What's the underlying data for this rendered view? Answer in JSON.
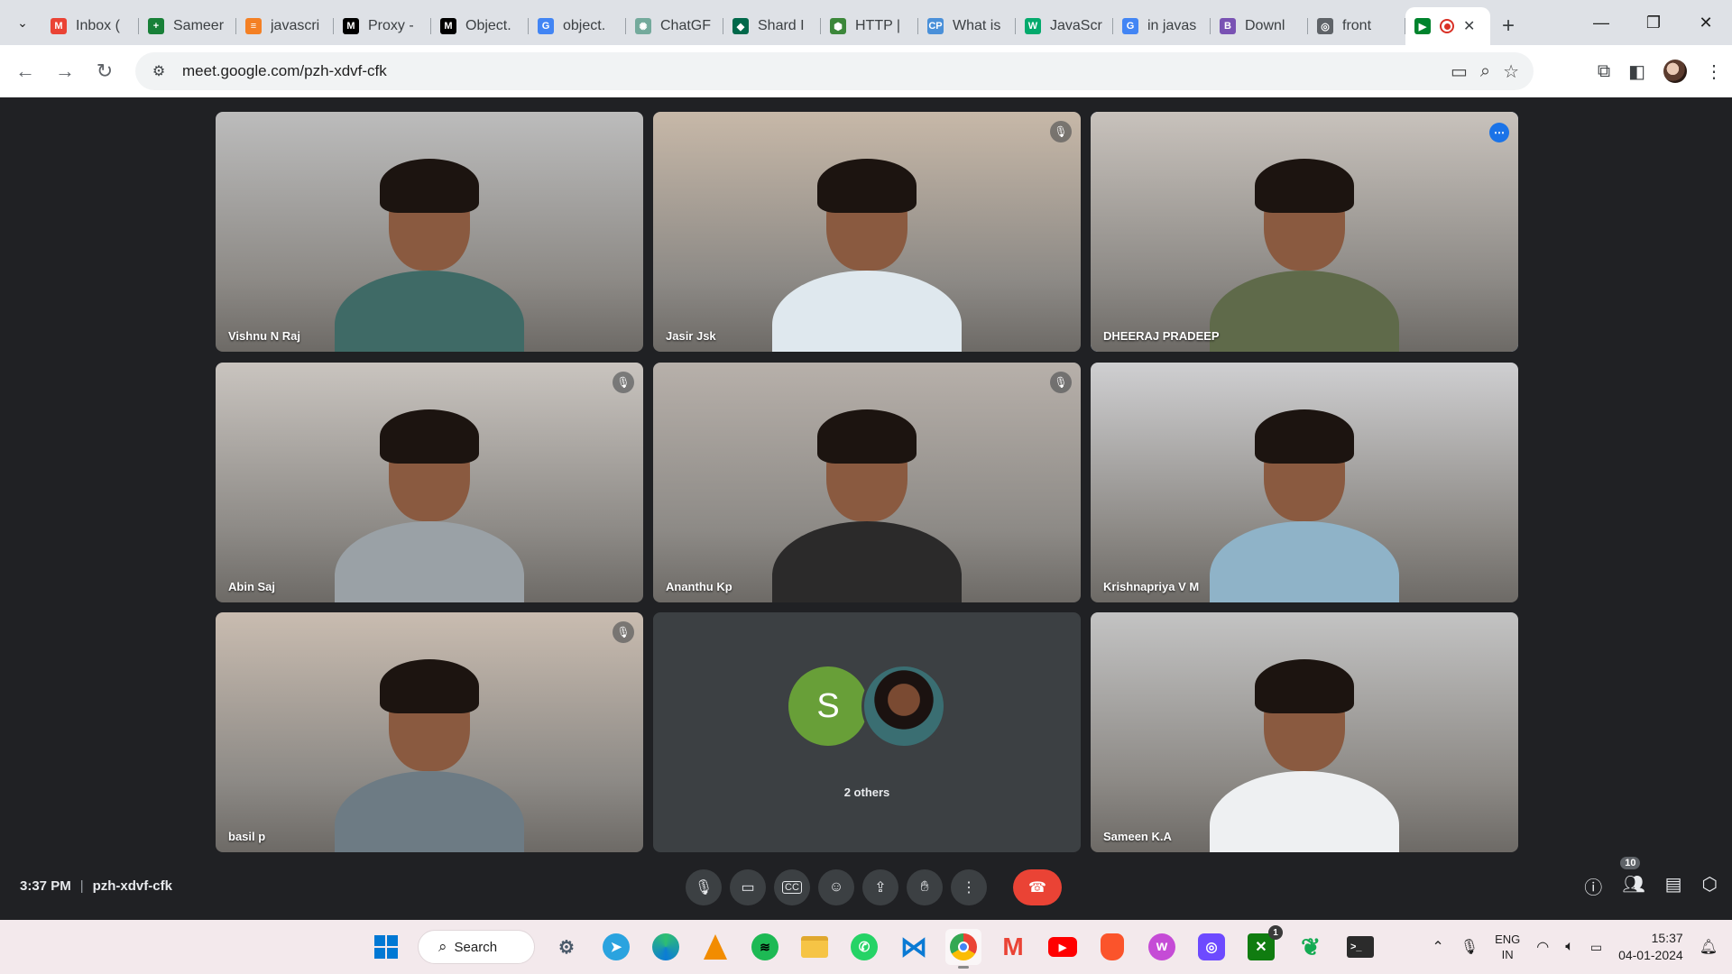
{
  "browser": {
    "tabs": [
      {
        "title": "Inbox (",
        "icon": "gmail-icon",
        "color": "#ea4335",
        "glyph": "M"
      },
      {
        "title": "Sameer",
        "icon": "sheets-icon",
        "color": "#188038",
        "glyph": "+"
      },
      {
        "title": "javascri",
        "icon": "stackoverflow-icon",
        "color": "#f48024",
        "glyph": "≡"
      },
      {
        "title": "Proxy -",
        "icon": "medium-icon",
        "color": "#000000",
        "glyph": "M"
      },
      {
        "title": "Object.",
        "icon": "medium-icon",
        "color": "#000000",
        "glyph": "M"
      },
      {
        "title": "object.",
        "icon": "google-icon",
        "color": "#4285f4",
        "glyph": "G"
      },
      {
        "title": "ChatGF",
        "icon": "chatgpt-icon",
        "color": "#74aa9c",
        "glyph": "✺"
      },
      {
        "title": "Shard I",
        "icon": "mongodb-icon",
        "color": "#00684a",
        "glyph": "◆"
      },
      {
        "title": "HTTP |",
        "icon": "nodejs-icon",
        "color": "#3c873a",
        "glyph": "⬢"
      },
      {
        "title": "What is",
        "icon": "codeproject-icon",
        "color": "#4a90d9",
        "glyph": "CP"
      },
      {
        "title": "JavaScr",
        "icon": "w3schools-icon",
        "color": "#04aa6d",
        "glyph": "W"
      },
      {
        "title": "in javas",
        "icon": "google-icon",
        "color": "#4285f4",
        "glyph": "G"
      },
      {
        "title": "Downl",
        "icon": "bootstrap-icon",
        "color": "#7952b3",
        "glyph": "B"
      },
      {
        "title": "front",
        "icon": "globe-icon",
        "color": "#5f6368",
        "glyph": "◎"
      }
    ],
    "active_tab": {
      "icon": "meet-icon"
    },
    "url": "meet.google.com/pzh-xdvf-cfk"
  },
  "meeting": {
    "participants": [
      {
        "name": "Vishnu N Raj",
        "muted": false,
        "bg": "#bcbcbc",
        "shirt": "#3f6a66"
      },
      {
        "name": "Jasir Jsk",
        "muted": true,
        "bg": "#c7b8a8",
        "shirt": "#dfe8ee"
      },
      {
        "name": "DHEERAJ PRADEEP",
        "muted": false,
        "bg": "#c8c2bc",
        "shirt": "#5f6a4a",
        "active": true
      },
      {
        "name": "Abin Saj",
        "muted": true,
        "bg": "#c9c4bf",
        "shirt": "#9aa1a6"
      },
      {
        "name": "Ananthu Kp",
        "muted": true,
        "bg": "#b7b0aa",
        "shirt": "#2b2a2a"
      },
      {
        "name": "Krishnapriya V M",
        "muted": false,
        "bg": "#cfcfd1",
        "shirt": "#8fb3c8"
      },
      {
        "name": "basil p",
        "muted": true,
        "bg": "#c9bcb0",
        "shirt": "#6d7b84"
      },
      {
        "name": "Sameen K.A",
        "muted": false,
        "bg": "#c3c3c3",
        "shirt": "#eef0f2"
      }
    ],
    "others": {
      "label": "2 others",
      "initial": "S",
      "initial_color": "#689f38"
    },
    "time": "3:37 PM",
    "code": "pzh-xdvf-cfk",
    "people_count": "10"
  },
  "taskbar": {
    "search_label": "Search",
    "lang_line1": "ENG",
    "lang_line2": "IN",
    "time": "15:37",
    "date": "04-01-2024",
    "xbox_badge": "1"
  }
}
